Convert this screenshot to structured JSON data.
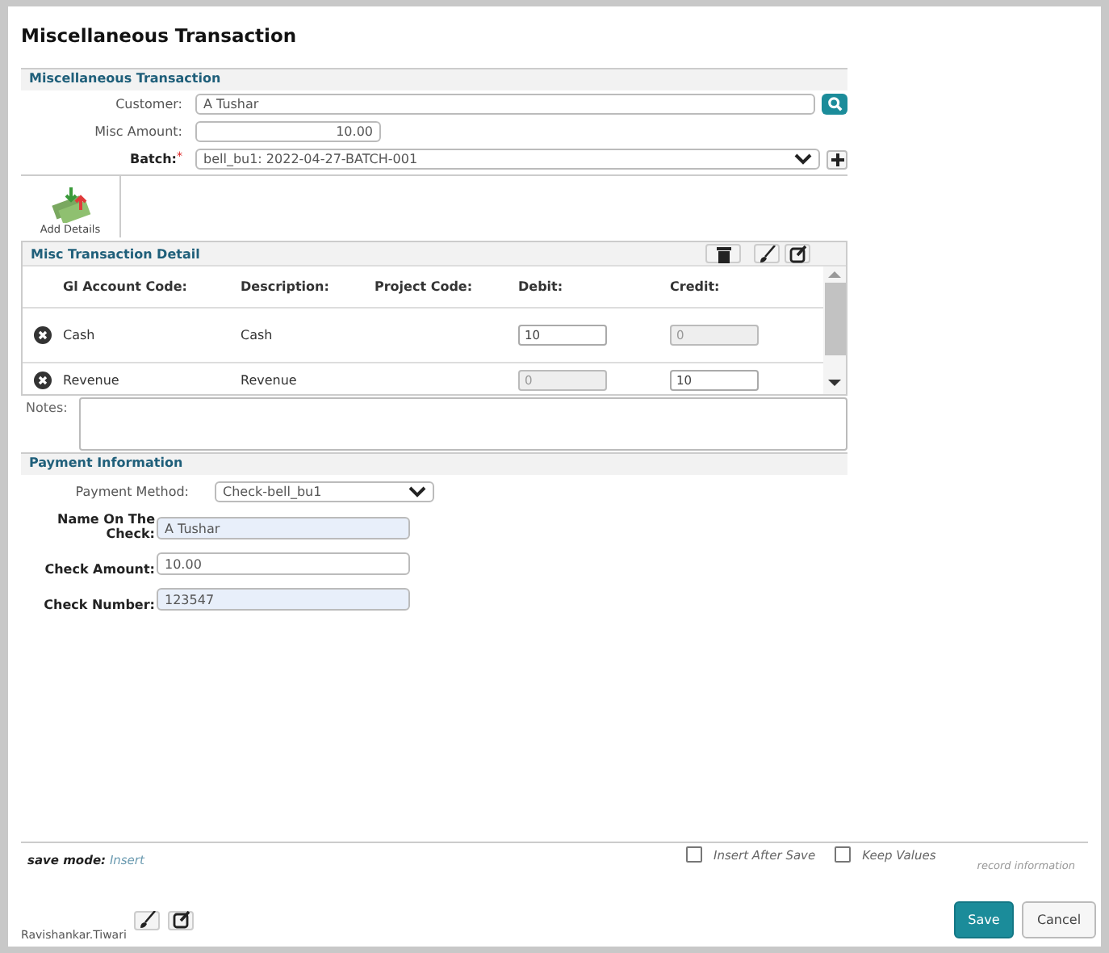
{
  "window": {
    "title": "Miscellaneous Transaction"
  },
  "header_section": {
    "title": "Miscellaneous Transaction",
    "customer": {
      "label": "Customer:",
      "value": "A Tushar"
    },
    "misc_amount": {
      "label": "Misc Amount:",
      "value": "10.00"
    },
    "batch": {
      "label": "Batch:",
      "required_mark": "*",
      "value": "bell_bu1: 2022-04-27-BATCH-001"
    }
  },
  "add_details": {
    "label": "Add Details"
  },
  "detail": {
    "title": "Misc Transaction Detail",
    "columns": [
      "Gl Account Code:",
      "Description:",
      "Project Code:",
      "Debit:",
      "Credit:"
    ],
    "rows": [
      {
        "account": "Cash",
        "description": "Cash",
        "debit": {
          "value": "10",
          "disabled": false
        },
        "credit": {
          "value": "0",
          "disabled": true
        }
      },
      {
        "account": "Revenue",
        "description": "Revenue",
        "debit": {
          "value": "0",
          "disabled": true
        },
        "credit": {
          "value": "10",
          "disabled": false
        }
      }
    ]
  },
  "notes": {
    "label": "Notes:"
  },
  "payment": {
    "title": "Payment Information",
    "method": {
      "label": "Payment Method:",
      "value": "Check-bell_bu1"
    },
    "fields": [
      {
        "label": "Name On The Check:",
        "value": "A Tushar",
        "highlighted": true
      },
      {
        "label": "Check Amount:",
        "value": "10.00",
        "highlighted": false
      },
      {
        "label": "Check Number:",
        "value": "123547",
        "highlighted": true
      }
    ]
  },
  "footer": {
    "save_mode_label": "save mode:",
    "save_mode": "Insert",
    "options": [
      {
        "label": "Insert After Save",
        "checked": false
      },
      {
        "label": "Keep Values",
        "checked": false
      }
    ],
    "record_info": "record information",
    "user": "Ravishankar.Tiwari",
    "buttons": [
      {
        "label": "Save",
        "kind": "primary"
      },
      {
        "label": "Cancel",
        "kind": "secondary"
      }
    ]
  }
}
